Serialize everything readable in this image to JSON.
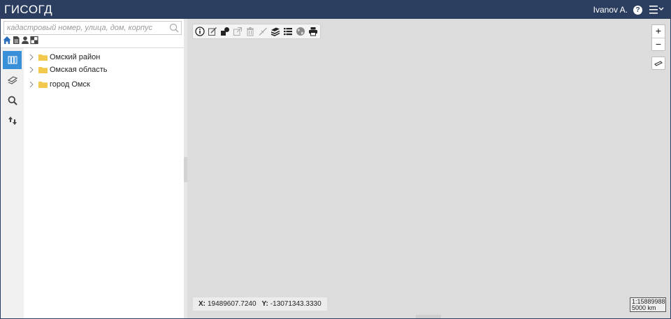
{
  "header": {
    "app_title": "ГИСОГД",
    "user_name": "Ivanov A.",
    "help_icon": "question-circle-icon",
    "menu_icon": "hamburger-menu-icon"
  },
  "sidebar": {
    "search": {
      "placeholder": "кадастровый номер, улица, дом, корпус",
      "value": "",
      "icon": "search-icon"
    },
    "filter_icons": [
      "home-icon",
      "document-icon",
      "person-icon",
      "grid-icon"
    ],
    "tabs": [
      {
        "icon": "books-icon",
        "active": true
      },
      {
        "icon": "layers-icon",
        "active": false
      },
      {
        "icon": "magnifier-icon",
        "active": false
      },
      {
        "icon": "sort-arrows-icon",
        "active": false
      }
    ],
    "tree": [
      {
        "label": "Омский район"
      },
      {
        "label": "Омская область"
      },
      {
        "label": "город Омск"
      }
    ]
  },
  "map": {
    "toolbar_tools": [
      "info-icon",
      "edit-icon",
      "select-shapes-icon",
      "external-link-icon",
      "delete-icon",
      "draw-line-icon",
      "layers-stack-icon",
      "list-icon",
      "globe-icon",
      "print-icon"
    ],
    "zoom_in_label": "+",
    "zoom_out_label": "−",
    "measure_icon": "ruler-icon",
    "coordinates": {
      "x_label": "X:",
      "x_value": "19489607.7240",
      "y_label": "Y:",
      "y_value": "-13071343.3330"
    },
    "scale": {
      "ratio": "1:15889988",
      "distance": "5000 km"
    }
  },
  "colors": {
    "header_bg": "#2c3e5f",
    "accent": "#3a8fd9",
    "folder": "#f2c94c",
    "map_bg": "#dcdcdc"
  }
}
